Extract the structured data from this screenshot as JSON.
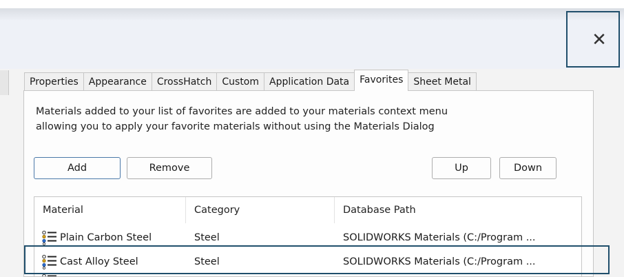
{
  "window": {
    "close_glyph": "✕"
  },
  "tabs": [
    {
      "label": "Properties",
      "active": false
    },
    {
      "label": "Appearance",
      "active": false
    },
    {
      "label": "CrossHatch",
      "active": false
    },
    {
      "label": "Custom",
      "active": false
    },
    {
      "label": "Application Data",
      "active": false
    },
    {
      "label": "Favorites",
      "active": true
    },
    {
      "label": "Sheet Metal",
      "active": false
    }
  ],
  "favorites": {
    "description_line1": "Materials added to your list of favorites are added to your materials context menu",
    "description_line2": "allowing you to apply your favorite materials without using the Materials Dialog",
    "buttons": {
      "add": "Add",
      "remove": "Remove",
      "up": "Up",
      "down": "Down"
    },
    "columns": [
      "Material",
      "Category",
      "Database Path"
    ],
    "rows": [
      {
        "material": "Plain Carbon Steel",
        "category": "Steel",
        "path": "SOLIDWORKS Materials (C:/Program ..."
      },
      {
        "material": "Cast Alloy Steel",
        "category": "Steel",
        "path": "SOLIDWORKS Materials (C:/Program ...",
        "highlighted": true
      }
    ]
  },
  "colors": {
    "highlight_border": "#1f4e6b",
    "default_button_border": "#4a78a8"
  },
  "icons": {
    "close": "close-icon",
    "material": "material-list-icon"
  }
}
